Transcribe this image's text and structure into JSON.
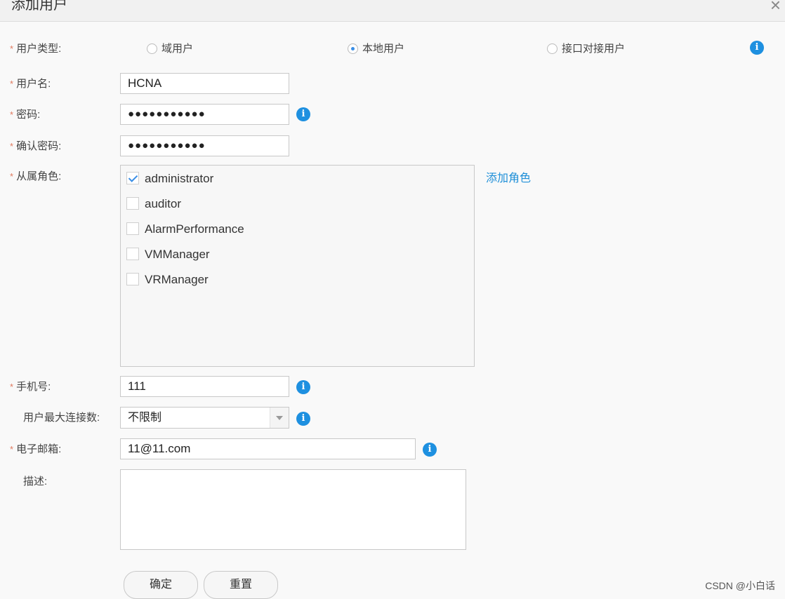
{
  "dialog": {
    "title": "添加用户",
    "close": "×"
  },
  "form": {
    "required_mark": "*",
    "user_type": {
      "label": "用户类型:",
      "options": [
        "域用户",
        "本地用户",
        "接口对接用户"
      ],
      "selected": "本地用户"
    },
    "username": {
      "label": "用户名:",
      "value": "HCNA"
    },
    "password": {
      "label": "密码:",
      "value": "●●●●●●●●●●●"
    },
    "confirm_password": {
      "label": "确认密码:",
      "value": "●●●●●●●●●●●"
    },
    "roles": {
      "label": "从属角色:",
      "add_role_link": "添加角色",
      "items": [
        {
          "label": "administrator",
          "checked": true
        },
        {
          "label": "auditor",
          "checked": false
        },
        {
          "label": "AlarmPerformance",
          "checked": false
        },
        {
          "label": "VMManager",
          "checked": false
        },
        {
          "label": "VRManager",
          "checked": false
        }
      ]
    },
    "phone": {
      "label": "手机号:",
      "value": "111"
    },
    "max_connections": {
      "label": "用户最大连接数:",
      "value": "不限制"
    },
    "email": {
      "label": "电子邮箱:",
      "value": "11@11.com"
    },
    "description": {
      "label": "描述:",
      "value": ""
    }
  },
  "buttons": {
    "confirm": "确定",
    "reset": "重置"
  },
  "info_icon_glyph": "i",
  "watermark": "CSDN @小白话",
  "colors": {
    "accent": "#1e90e0",
    "link": "#1e8fd8",
    "required": "#e07a5f"
  }
}
